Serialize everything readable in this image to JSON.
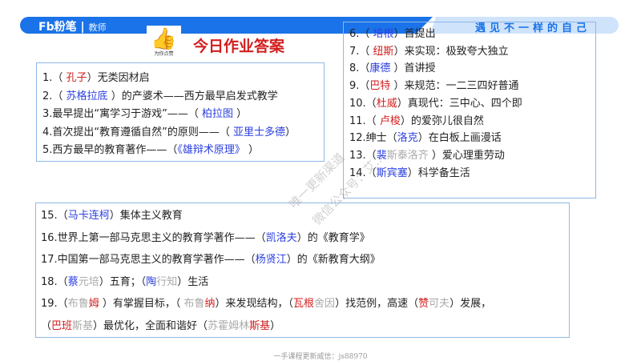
{
  "header": {
    "brand": "Fb粉笔",
    "brand_sub": "教师",
    "slogan": "遇见不一样的自己",
    "sticker_text": "为你点赞",
    "title": "今日作业答案"
  },
  "box1": [
    [
      [
        "1.（ ",
        "k"
      ],
      [
        "孔子",
        "r"
      ],
      [
        "）无类因材启",
        "k"
      ]
    ],
    [
      [
        "2.（ ",
        "k"
      ],
      [
        "苏格拉底",
        "b"
      ],
      [
        " ）的产婆术——西方最早启发式教学",
        "k"
      ]
    ],
    [
      [
        "3.最早提出“寓学习于游戏”——（ ",
        "k"
      ],
      [
        "柏拉图",
        "b"
      ],
      [
        " ）",
        "k"
      ]
    ],
    [
      [
        "4.首次提出“教育遵循自然”的原则——（ ",
        "k"
      ],
      [
        "亚里士多德",
        "b"
      ],
      [
        "）",
        "k"
      ]
    ],
    [
      [
        "5.西方最早的教育著作——（",
        "k"
      ],
      [
        "《雄辩术原理》",
        "b"
      ],
      [
        " ）",
        "k"
      ]
    ]
  ],
  "box2": [
    [
      [
        "6.（ ",
        "k"
      ],
      [
        "培根",
        "b"
      ],
      [
        "）首提出",
        "k"
      ]
    ],
    [
      [
        "7.（ ",
        "k"
      ],
      [
        "纽斯",
        "r"
      ],
      [
        "）来实现：极致夸大独立",
        "k"
      ]
    ],
    [
      [
        "8.（",
        "k"
      ],
      [
        "康德",
        "b"
      ],
      [
        " ）首讲授",
        "k"
      ]
    ],
    [
      [
        "9.（",
        "k"
      ],
      [
        "巴特",
        "r"
      ],
      [
        " ）来规范：一二三四好普通",
        "k"
      ]
    ],
    [
      [
        "10.（",
        "k"
      ],
      [
        "杜威",
        "r"
      ],
      [
        "）真现代：三中心、四个即",
        "k"
      ]
    ],
    [
      [
        "11.（ ",
        "k"
      ],
      [
        "卢梭",
        "r"
      ],
      [
        "）的爱弥儿很自然",
        "k"
      ]
    ],
    [
      [
        "12.绅士（",
        "k"
      ],
      [
        "洛克",
        "b"
      ],
      [
        "）在白板上画漫话",
        "k"
      ]
    ],
    [
      [
        "13.（",
        "k"
      ],
      [
        "裴",
        "b"
      ],
      [
        "斯泰洛齐",
        "g"
      ],
      [
        " ）爱心理重劳动",
        "k"
      ]
    ],
    [
      [
        "14.（",
        "k"
      ],
      [
        "斯宾塞",
        "b"
      ],
      [
        "）科学备生活",
        "k"
      ]
    ]
  ],
  "box3": [
    [
      [
        "15.（",
        "k"
      ],
      [
        "马卡连柯",
        "b"
      ],
      [
        "）集体主义教育",
        "k"
      ]
    ],
    [
      [
        "16.世界上第一部马克思主义的教育学著作——（",
        "k"
      ],
      [
        "凯洛夫",
        "b"
      ],
      [
        "）的《教育学》",
        "k"
      ]
    ],
    [
      [
        "17.中国第一部马克思主义的教育学著作——（",
        "k"
      ],
      [
        "杨贤江",
        "b"
      ],
      [
        "）的《新教育大纲》",
        "k"
      ]
    ],
    [
      [
        "18.（",
        "k"
      ],
      [
        "蔡",
        "b"
      ],
      [
        "元培",
        "g"
      ],
      [
        "）五育；（",
        "k"
      ],
      [
        "陶",
        "b"
      ],
      [
        "行知",
        "g"
      ],
      [
        "）生活",
        "k"
      ]
    ],
    [
      [
        "19.（",
        "k"
      ],
      [
        "布鲁",
        "g"
      ],
      [
        "姆",
        "r"
      ],
      [
        " ）有掌握目标，（ ",
        "k"
      ],
      [
        "布鲁",
        "g"
      ],
      [
        "纳",
        "r"
      ],
      [
        "）来发现结构，（",
        "k"
      ],
      [
        "瓦根",
        "r"
      ],
      [
        "舍因",
        "g"
      ],
      [
        "）找范例，高速（",
        "k"
      ],
      [
        "赞",
        "r"
      ],
      [
        "可夫",
        "g"
      ],
      [
        "）发展，",
        "k"
      ]
    ],
    [
      [
        " （",
        "k"
      ],
      [
        "巴班",
        "r"
      ],
      [
        "斯基",
        "g"
      ],
      [
        "）最优化，全面和谐好（",
        "k"
      ],
      [
        "苏霍姆林",
        "g"
      ],
      [
        "斯基",
        "r"
      ],
      [
        "）",
        "k"
      ]
    ]
  ],
  "watermark": {
    "line1": "唯一更新渠道",
    "line2": "微信公众号：艾..."
  },
  "footer": "一手课程更新威信：js88970"
}
